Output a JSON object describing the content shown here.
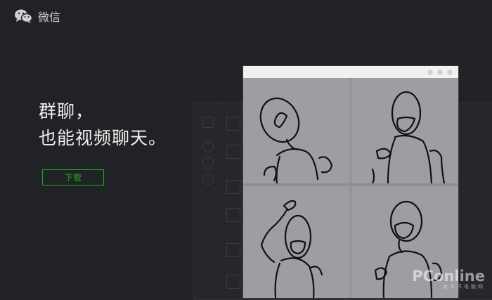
{
  "header": {
    "app_name": "微信",
    "logo_icon": "wechat-logo-icon"
  },
  "hero": {
    "line1": "群聊，",
    "line2": "也能视频聊天。",
    "download_label": "下载"
  },
  "colors": {
    "background": "#212225",
    "accent": "#1aad19"
  },
  "watermark": {
    "text": "PConline",
    "sub": "太平洋电脑网"
  }
}
